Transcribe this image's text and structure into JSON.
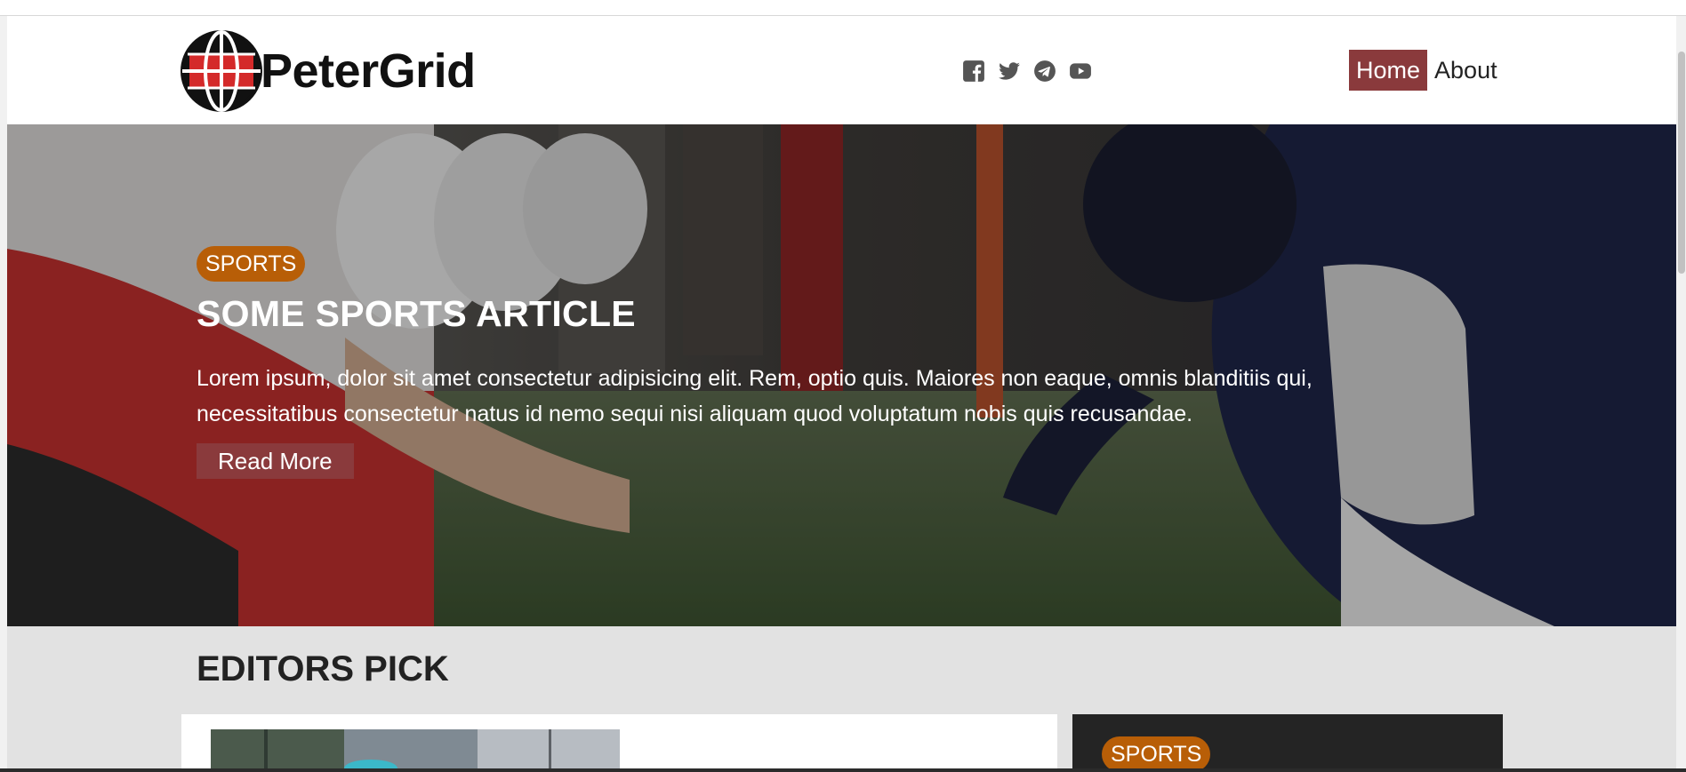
{
  "brand": {
    "name": "PeterGrid",
    "accent_color": "#8a3a3c",
    "badge_color": "#b85e07"
  },
  "social_icons": [
    "facebook-icon",
    "twitter-icon",
    "telegram-icon",
    "youtube-icon"
  ],
  "nav": {
    "items": [
      {
        "label": "Home",
        "active": true
      },
      {
        "label": "About",
        "active": false
      }
    ]
  },
  "hero": {
    "category": "SPORTS",
    "title": "SOME SPORTS ARTICLE",
    "text": "Lorem ipsum, dolor sit amet consectetur adipisicing elit. Rem, optio quis. Maiores non eaque, omnis blanditiis qui, necessitatibus consectetur natus id nemo sequi nisi aliquam quod voluptatum nobis quis recusandae.",
    "button_label": "Read More"
  },
  "editors_pick": {
    "title": "EDITORS PICK",
    "side_card_category": "SPORTS"
  }
}
